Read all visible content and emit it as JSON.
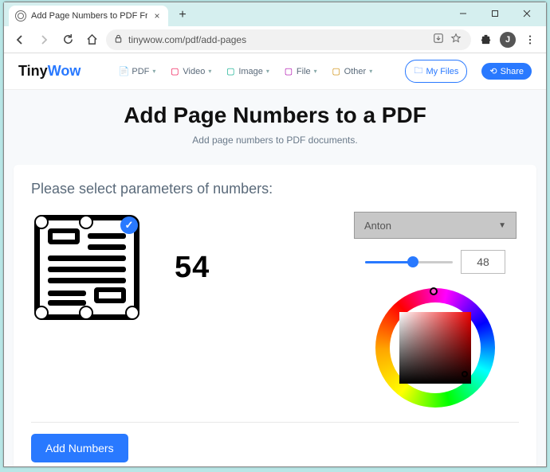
{
  "browser": {
    "tab_title": "Add Page Numbers to PDF Free",
    "url": "tinywow.com/pdf/add-pages",
    "avatar_initial": "J"
  },
  "nav": {
    "logo_tiny": "Tiny",
    "logo_wow": "Wow",
    "links": {
      "pdf": "PDF",
      "video": "Video",
      "image": "Image",
      "file": "File",
      "other": "Other"
    },
    "myfiles": "My Files",
    "share": "Share"
  },
  "hero": {
    "title": "Add Page Numbers to a PDF",
    "subtitle": "Add page numbers to PDF documents."
  },
  "card": {
    "title": "Please select parameters of numbers:",
    "preview_number": "54",
    "font_selected": "Anton",
    "size_value": "48",
    "add_button": "Add Numbers"
  }
}
